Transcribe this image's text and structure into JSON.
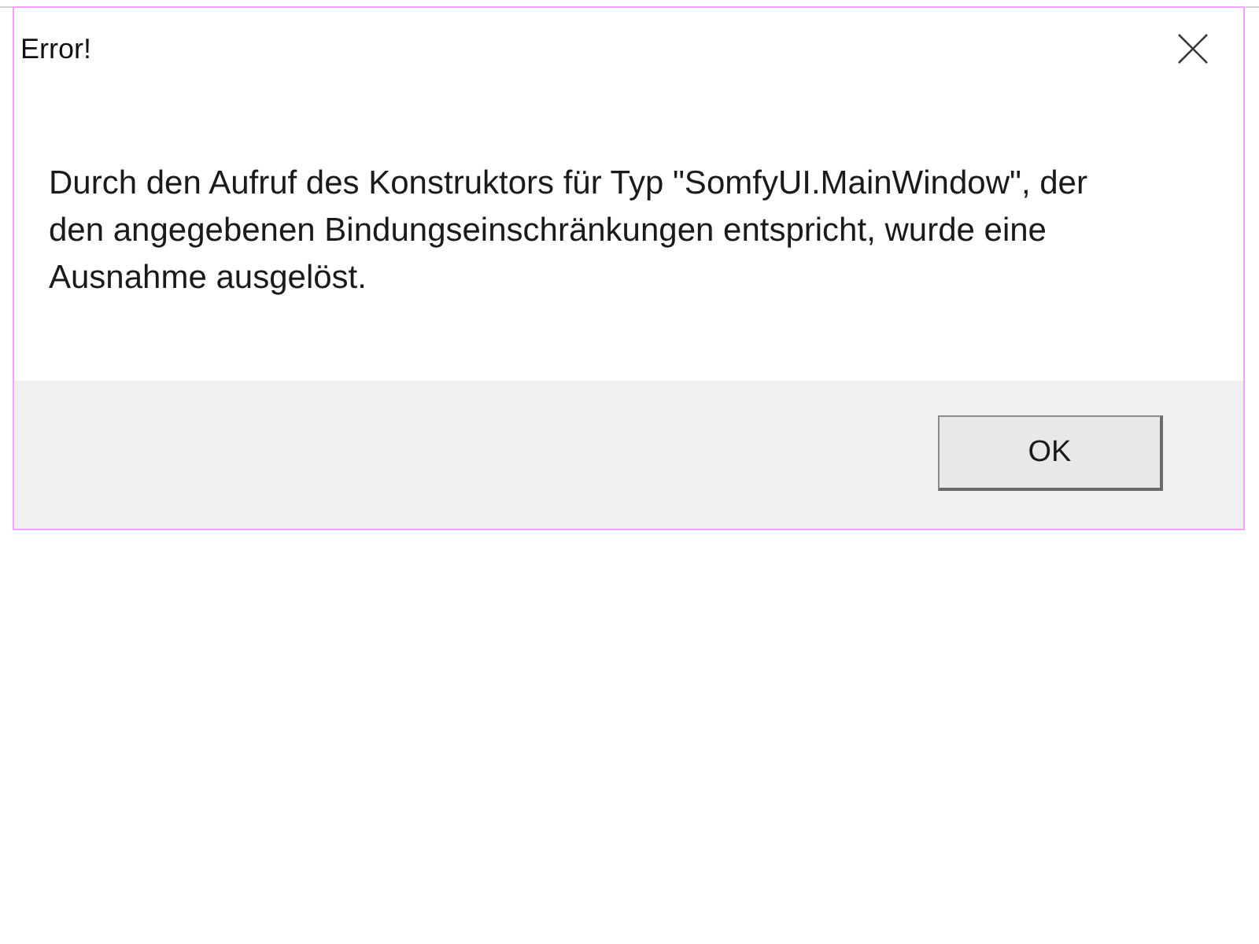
{
  "window": {
    "title": "Error!"
  },
  "message": "Durch den Aufruf des Konstruktors für Typ \"SomfyUI.MainWindow\", der den angegebenen Bindungseinschränkungen entspricht, wurde eine Ausnahme ausgelöst.",
  "buttons": [
    {
      "label": "OK"
    }
  ]
}
